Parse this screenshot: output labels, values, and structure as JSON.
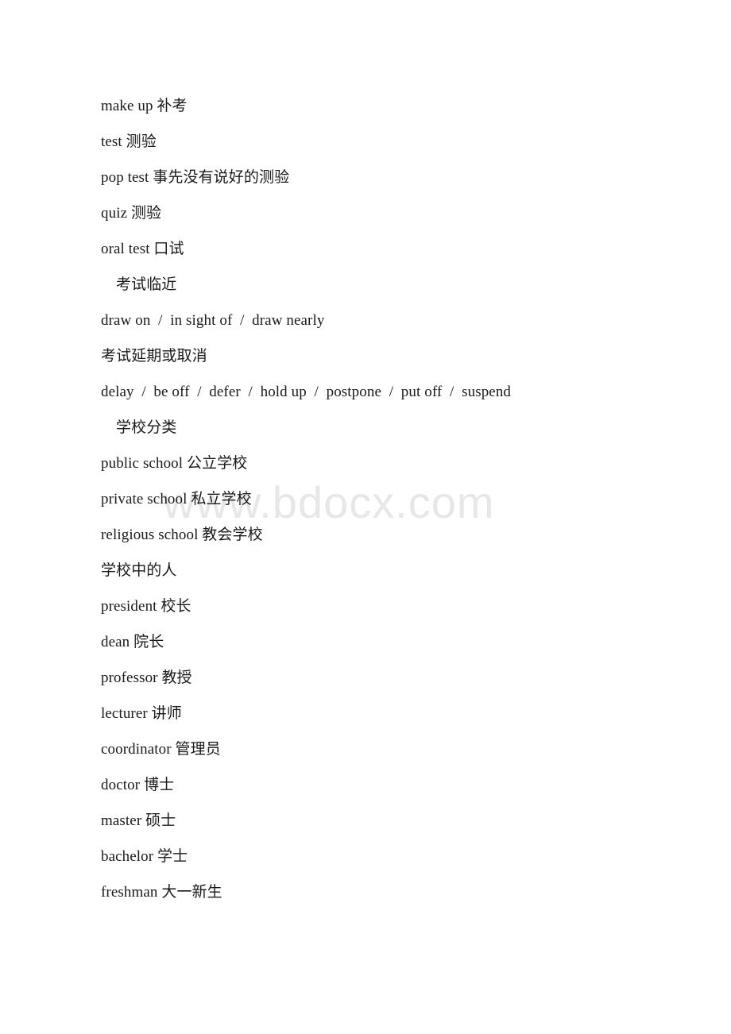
{
  "document": {
    "watermark": "www.bdocx.com",
    "blocks": [
      {
        "type": "entry",
        "text": "make up 补考"
      },
      {
        "type": "entry",
        "text": "test 测验"
      },
      {
        "type": "entry",
        "text": "pop test 事先没有说好的测验"
      },
      {
        "type": "entry",
        "text": "quiz 测验"
      },
      {
        "type": "entry",
        "text": "oral test 口试"
      },
      {
        "type": "heading",
        "text": "考试临近"
      },
      {
        "type": "entry",
        "text": "draw on  /  in sight of  /  draw nearly"
      },
      {
        "type": "entry",
        "text": "考试延期或取消"
      },
      {
        "type": "entry",
        "text": "delay  /  be off  /  defer  /  hold up  /  postpone  /  put off  /  suspend"
      },
      {
        "type": "heading",
        "text": "学校分类"
      },
      {
        "type": "entry",
        "text": "public school 公立学校"
      },
      {
        "type": "entry",
        "text": "private school 私立学校"
      },
      {
        "type": "entry",
        "text": "religious school 教会学校"
      },
      {
        "type": "entry",
        "text": "学校中的人"
      },
      {
        "type": "entry",
        "text": "president 校长"
      },
      {
        "type": "entry",
        "text": "dean 院长"
      },
      {
        "type": "entry",
        "text": "professor 教授"
      },
      {
        "type": "entry",
        "text": "lecturer 讲师"
      },
      {
        "type": "entry",
        "text": "coordinator 管理员"
      },
      {
        "type": "entry",
        "text": "doctor 博士"
      },
      {
        "type": "entry",
        "text": "master 硕士"
      },
      {
        "type": "entry",
        "text": "bachelor 学士"
      },
      {
        "type": "entry",
        "text": "freshman 大一新生"
      }
    ]
  },
  "colors": {
    "text": "#1a1a1a",
    "watermark": "#e7e7e7",
    "background": "#ffffff"
  }
}
